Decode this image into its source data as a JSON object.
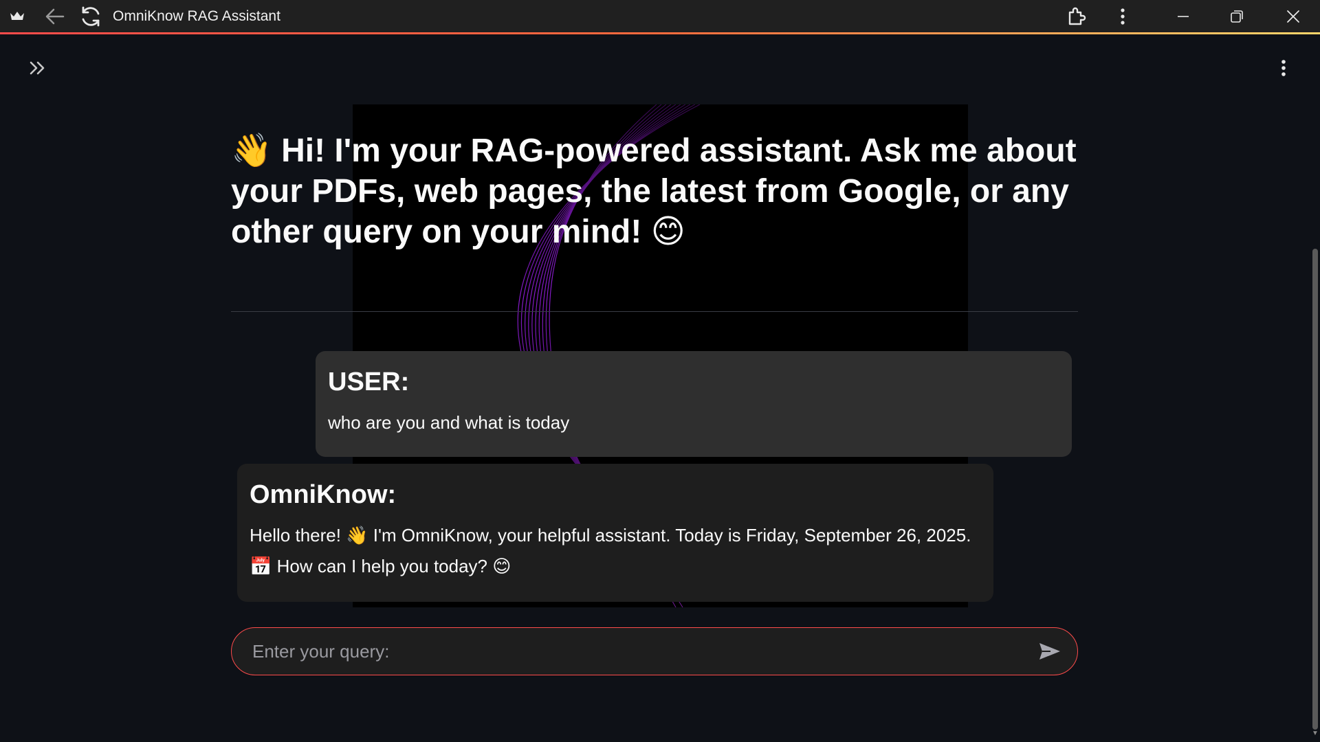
{
  "window": {
    "title": "OmniKnow RAG Assistant"
  },
  "heading": {
    "emoji_wave": "👋",
    "text": "Hi! I'm your RAG-powered assistant. Ask me about your PDFs, web pages, the latest from Google, or any other query on your mind!",
    "emoji_smile": "😊"
  },
  "messages": [
    {
      "role_label": "USER:",
      "text": "who are you and what is today"
    },
    {
      "role_label": "OmniKnow:",
      "text_line1": "Hello there! 👋 I'm OmniKnow, your helpful assistant. Today is Friday, September 26, 2025.",
      "text_line2": "📅 How can I help you today? 😊"
    }
  ],
  "input": {
    "placeholder": "Enter your query:",
    "value": ""
  },
  "colors": {
    "accent": "#ff4b4b",
    "background": "#0e1117",
    "user_bubble": "#2f2f2f",
    "bot_bubble": "#1e1e1e",
    "art": "#a020f0"
  },
  "icons": {
    "app": "crown-icon",
    "back": "back-arrow-icon",
    "reload": "reload-icon",
    "extensions": "extension-puzzle-icon",
    "browser_menu": "vertical-dots-icon",
    "minimize": "minimize-icon",
    "maximize": "restore-icon",
    "close": "close-icon",
    "sidebar": "double-chevron-right-icon",
    "app_menu": "vertical-dots-icon",
    "send": "send-icon"
  }
}
